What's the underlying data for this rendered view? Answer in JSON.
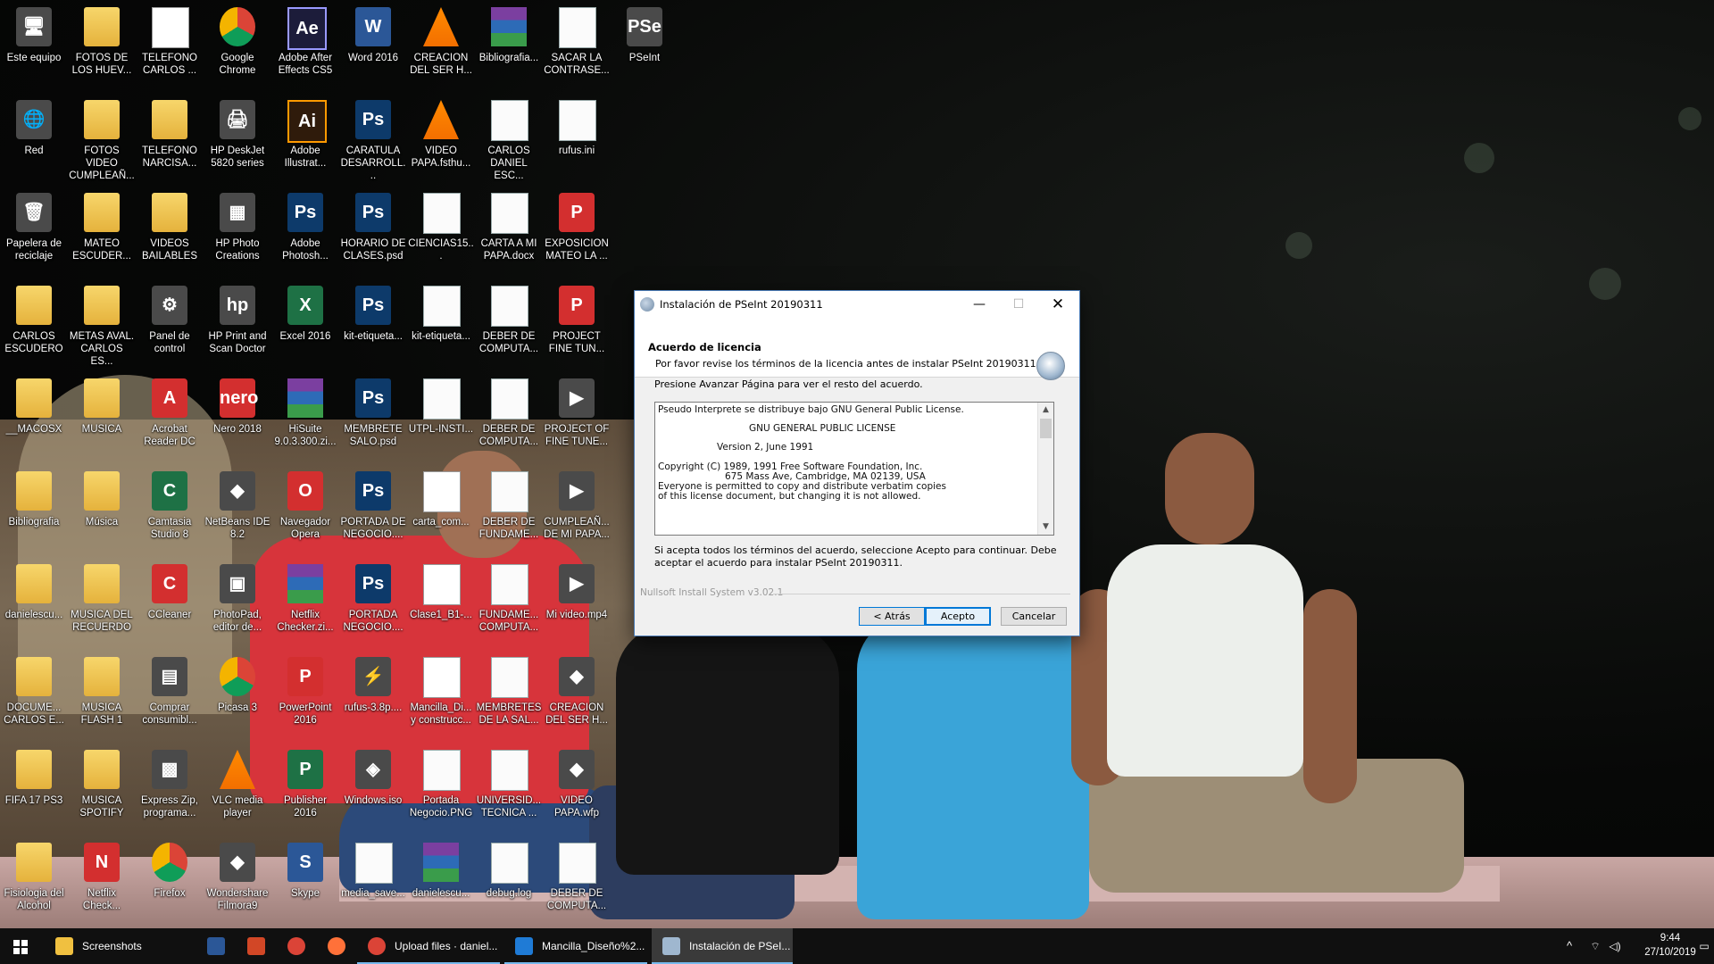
{
  "desktop": {
    "icons": [
      {
        "label": "Este equipo",
        "kind": "app",
        "glyph": "🖥"
      },
      {
        "label": "FOTOS DE LOS HUEV...",
        "kind": "folder"
      },
      {
        "label": "TELEFONO CARLOS ...",
        "kind": "pdf"
      },
      {
        "label": "Google Chrome",
        "kind": "chrome"
      },
      {
        "label": "Adobe After Effects CS5",
        "kind": "ae",
        "glyph": "Ae"
      },
      {
        "label": "Word 2016",
        "kind": "word",
        "glyph": "W"
      },
      {
        "label": "CREACION DEL SER H...",
        "kind": "vlc"
      },
      {
        "label": "Bibliografia...",
        "kind": "rar"
      },
      {
        "label": "SACAR LA CONTRASE...",
        "kind": "doc"
      },
      {
        "label": "PSeInt",
        "kind": "app",
        "glyph": "PSe"
      },
      {
        "label": "Red",
        "kind": "app",
        "glyph": "🌐"
      },
      {
        "label": "FOTOS VIDEO CUMPLEAÑ...",
        "kind": "folder"
      },
      {
        "label": "TELEFONO NARCISA...",
        "kind": "folder"
      },
      {
        "label": "HP DeskJet 5820 series",
        "kind": "app",
        "glyph": "🖨"
      },
      {
        "label": "Adobe Illustrat...",
        "kind": "ai",
        "glyph": "Ai"
      },
      {
        "label": "CARATULA DESARROLL...",
        "kind": "psd",
        "glyph": "Ps"
      },
      {
        "label": "VIDEO PAPA.fsthu...",
        "kind": "vlc"
      },
      {
        "label": "CARLOS DANIEL ESC...",
        "kind": "doc"
      },
      {
        "label": "rufus.ini",
        "kind": "doc"
      },
      {
        "label": "Papelera de reciclaje",
        "kind": "app",
        "glyph": "🗑"
      },
      {
        "label": "MATEO ESCUDER...",
        "kind": "folder"
      },
      {
        "label": "VIDEOS BAILABLES",
        "kind": "folder"
      },
      {
        "label": "HP Photo Creations",
        "kind": "app",
        "glyph": "▦"
      },
      {
        "label": "Adobe Photosh...",
        "kind": "psd",
        "glyph": "Ps"
      },
      {
        "label": "HORARIO DE CLASES.psd",
        "kind": "psd",
        "glyph": "Ps"
      },
      {
        "label": "CIENCIAS15...",
        "kind": "doc"
      },
      {
        "label": "CARTA A MI PAPA.docx",
        "kind": "doc"
      },
      {
        "label": "EXPOSICION MATEO LA ...",
        "kind": "red",
        "glyph": "P"
      },
      {
        "label": "CARLOS ESCUDERO",
        "kind": "folder"
      },
      {
        "label": "METAS AVAL. CARLOS ES...",
        "kind": "folder"
      },
      {
        "label": "Panel de control",
        "kind": "app",
        "glyph": "⚙"
      },
      {
        "label": "HP Print and Scan Doctor",
        "kind": "app",
        "glyph": "hp"
      },
      {
        "label": "Excel 2016",
        "kind": "green",
        "glyph": "X"
      },
      {
        "label": "kit-etiqueta...",
        "kind": "psd",
        "glyph": "Ps"
      },
      {
        "label": "kit-etiqueta...",
        "kind": "doc"
      },
      {
        "label": "DEBER DE COMPUTA...",
        "kind": "doc"
      },
      {
        "label": "PROJECT FINE TUN...",
        "kind": "red",
        "glyph": "P"
      },
      {
        "label": "__MACOSX",
        "kind": "folder"
      },
      {
        "label": "MUSICA",
        "kind": "folder"
      },
      {
        "label": "Acrobat Reader DC",
        "kind": "red",
        "glyph": "A"
      },
      {
        "label": "Nero 2018",
        "kind": "red",
        "glyph": "nero"
      },
      {
        "label": "HiSuite 9.0.3.300.zi...",
        "kind": "rar"
      },
      {
        "label": "MEMBRETE SALO.psd",
        "kind": "psd",
        "glyph": "Ps"
      },
      {
        "label": "UTPL-INSTI...",
        "kind": "doc"
      },
      {
        "label": "DEBER DE COMPUTA...",
        "kind": "doc"
      },
      {
        "label": "PROJECT OF FINE TUNE...",
        "kind": "app",
        "glyph": "▶"
      },
      {
        "label": "Bibliografia",
        "kind": "folder"
      },
      {
        "label": "Música",
        "kind": "folder"
      },
      {
        "label": "Camtasia Studio 8",
        "kind": "green",
        "glyph": "C"
      },
      {
        "label": "NetBeans IDE 8.2",
        "kind": "app",
        "glyph": "◆"
      },
      {
        "label": "Navegador Opera",
        "kind": "red",
        "glyph": "O"
      },
      {
        "label": "PORTADA DE NEGOCIO....",
        "kind": "psd",
        "glyph": "Ps"
      },
      {
        "label": "carta_com...",
        "kind": "pdf"
      },
      {
        "label": "DEBER DE FUNDAME...",
        "kind": "doc"
      },
      {
        "label": "CUMPLEAÑ... DE MI PAPA...",
        "kind": "app",
        "glyph": "▶"
      },
      {
        "label": "danielescu...",
        "kind": "folder"
      },
      {
        "label": "MUSICA DEL RECUERDO",
        "kind": "folder"
      },
      {
        "label": "CCleaner",
        "kind": "red",
        "glyph": "C"
      },
      {
        "label": "PhotoPad, editor de...",
        "kind": "app",
        "glyph": "▣"
      },
      {
        "label": "Netflix Checker.zi...",
        "kind": "rar"
      },
      {
        "label": "PORTADA NEGOCIO....",
        "kind": "psd",
        "glyph": "Ps"
      },
      {
        "label": "Clase1_B1-...",
        "kind": "pdf"
      },
      {
        "label": "FUNDAME... COMPUTA...",
        "kind": "doc"
      },
      {
        "label": "Mi video.mp4",
        "kind": "app",
        "glyph": "▶"
      },
      {
        "label": "DOCUME... CARLOS E...",
        "kind": "folder"
      },
      {
        "label": "MUSICA FLASH 1",
        "kind": "folder"
      },
      {
        "label": "Comprar consumibl...",
        "kind": "app",
        "glyph": "▤"
      },
      {
        "label": "Picasa 3",
        "kind": "chrome"
      },
      {
        "label": "PowerPoint 2016",
        "kind": "red",
        "glyph": "P"
      },
      {
        "label": "rufus-3.8p....",
        "kind": "app",
        "glyph": "⚡"
      },
      {
        "label": "Mancilla_Di... y construcc...",
        "kind": "pdf"
      },
      {
        "label": "MEMBRETES DE LA SAL...",
        "kind": "doc"
      },
      {
        "label": "CREACION DEL SER H...",
        "kind": "app",
        "glyph": "◆"
      },
      {
        "label": "FIFA 17 PS3",
        "kind": "folder"
      },
      {
        "label": "MUSICA SPOTIFY",
        "kind": "folder"
      },
      {
        "label": "Express Zip, programa...",
        "kind": "app",
        "glyph": "▩"
      },
      {
        "label": "VLC media player",
        "kind": "vlc"
      },
      {
        "label": "Publisher 2016",
        "kind": "green",
        "glyph": "P"
      },
      {
        "label": "Windows.iso",
        "kind": "app",
        "glyph": "◈"
      },
      {
        "label": "Portada Negocio.PNG",
        "kind": "doc"
      },
      {
        "label": "UNIVERSID... TECNICA ...",
        "kind": "doc"
      },
      {
        "label": "VIDEO PAPA.wfp",
        "kind": "app",
        "glyph": "◆"
      },
      {
        "label": "Fisiologia del Alcohol",
        "kind": "folder"
      },
      {
        "label": "Netflix Check...",
        "kind": "red",
        "glyph": "N"
      },
      {
        "label": "Firefox",
        "kind": "chrome"
      },
      {
        "label": "Wondershare Filmora9",
        "kind": "app",
        "glyph": "◆"
      },
      {
        "label": "Skype",
        "kind": "word",
        "glyph": "S"
      },
      {
        "label": "media_save...",
        "kind": "doc"
      },
      {
        "label": "danielescu...",
        "kind": "rar"
      },
      {
        "label": "debug.log",
        "kind": "doc"
      },
      {
        "label": "DEBER DE COMPUTA...",
        "kind": "doc"
      }
    ]
  },
  "installer": {
    "title": "Instalación de PSeInt 20190311",
    "header_title": "Acuerdo de licencia",
    "header_subtitle": "Por favor revise los términos de la licencia antes de instalar PSeInt 20190311.",
    "instruction": "Presione Avanzar Página para ver el resto del acuerdo.",
    "license_lines": [
      "Pseudo Interprete se distribuye bajo GNU General Public License.",
      "GNU GENERAL PUBLIC LICENSE",
      "Version 2, June 1991",
      "Copyright (C) 1989, 1991 Free Software Foundation, Inc.",
      "675 Mass Ave, Cambridge, MA 02139, USA",
      "Everyone is permitted to copy and distribute verbatim copies",
      "of this license document, but changing it is not allowed."
    ],
    "accept_note": "Si acepta todos los términos del acuerdo, seleccione Acepto para continuar. Debe aceptar el acuerdo para instalar PSeInt 20190311.",
    "branding": "Nullsoft Install System v3.02.1",
    "buttons": {
      "back": "< Atrás",
      "accept": "Acepto",
      "cancel": "Cancelar"
    },
    "window_controls": {
      "minimize": "—",
      "maximize": "☐",
      "close": "✕"
    }
  },
  "taskbar": {
    "items": [
      {
        "label": "Screenshots",
        "icon": "folder-icon",
        "color": "#f0c040"
      },
      {
        "label": "",
        "icon": "word-icon",
        "color": "#2b5797"
      },
      {
        "label": "",
        "icon": "powerpoint-icon",
        "color": "#d24726"
      },
      {
        "label": "",
        "icon": "chrome-icon",
        "color": "#db4437"
      },
      {
        "label": "",
        "icon": "firefox-icon",
        "color": "#ff7139"
      },
      {
        "label": "Upload files · daniel...",
        "icon": "chrome-icon",
        "color": "#db4437"
      },
      {
        "label": "Mancilla_Diseño%2...",
        "icon": "edge-icon",
        "color": "#1f7bd6"
      },
      {
        "label": "Instalación de PSeI...",
        "icon": "installer-icon",
        "color": "#9fb7cf"
      }
    ],
    "tray": {
      "chevron": "^",
      "time": "9:44",
      "date": "27/10/2019"
    }
  }
}
